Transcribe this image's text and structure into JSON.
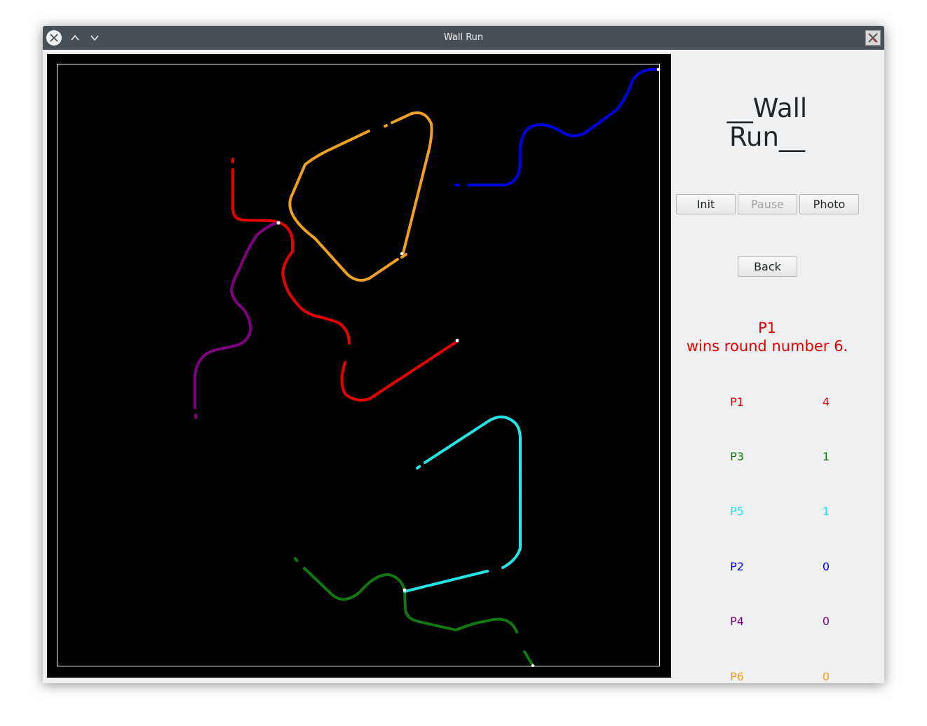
{
  "window": {
    "title": "Wall Run"
  },
  "panel": {
    "title_line1": "__Wall",
    "title_line2": "Run__",
    "buttons": {
      "init": "Init",
      "pause": "Pause",
      "photo": "Photo",
      "back": "Back"
    },
    "winner_line1": "P1",
    "winner_line2": "wins round number 6.",
    "scores": [
      {
        "name": "P1",
        "score": "4",
        "color": "#e60000"
      },
      {
        "name": "P3",
        "score": "1",
        "color": "#117711"
      },
      {
        "name": "P5",
        "score": "1",
        "color": "#22e6e6"
      },
      {
        "name": "P2",
        "score": "0",
        "color": "#0000e6"
      },
      {
        "name": "P4",
        "score": "0",
        "color": "#800080"
      },
      {
        "name": "P6",
        "score": "0",
        "color": "#f0a020"
      }
    ]
  },
  "trails": [
    {
      "player": "P1",
      "color": "#e60000"
    },
    {
      "player": "P2",
      "color": "#0000e6"
    },
    {
      "player": "P3",
      "color": "#117711"
    },
    {
      "player": "P4",
      "color": "#800080"
    },
    {
      "player": "P5",
      "color": "#22e6e6"
    },
    {
      "player": "P6",
      "color": "#f0a020"
    }
  ]
}
